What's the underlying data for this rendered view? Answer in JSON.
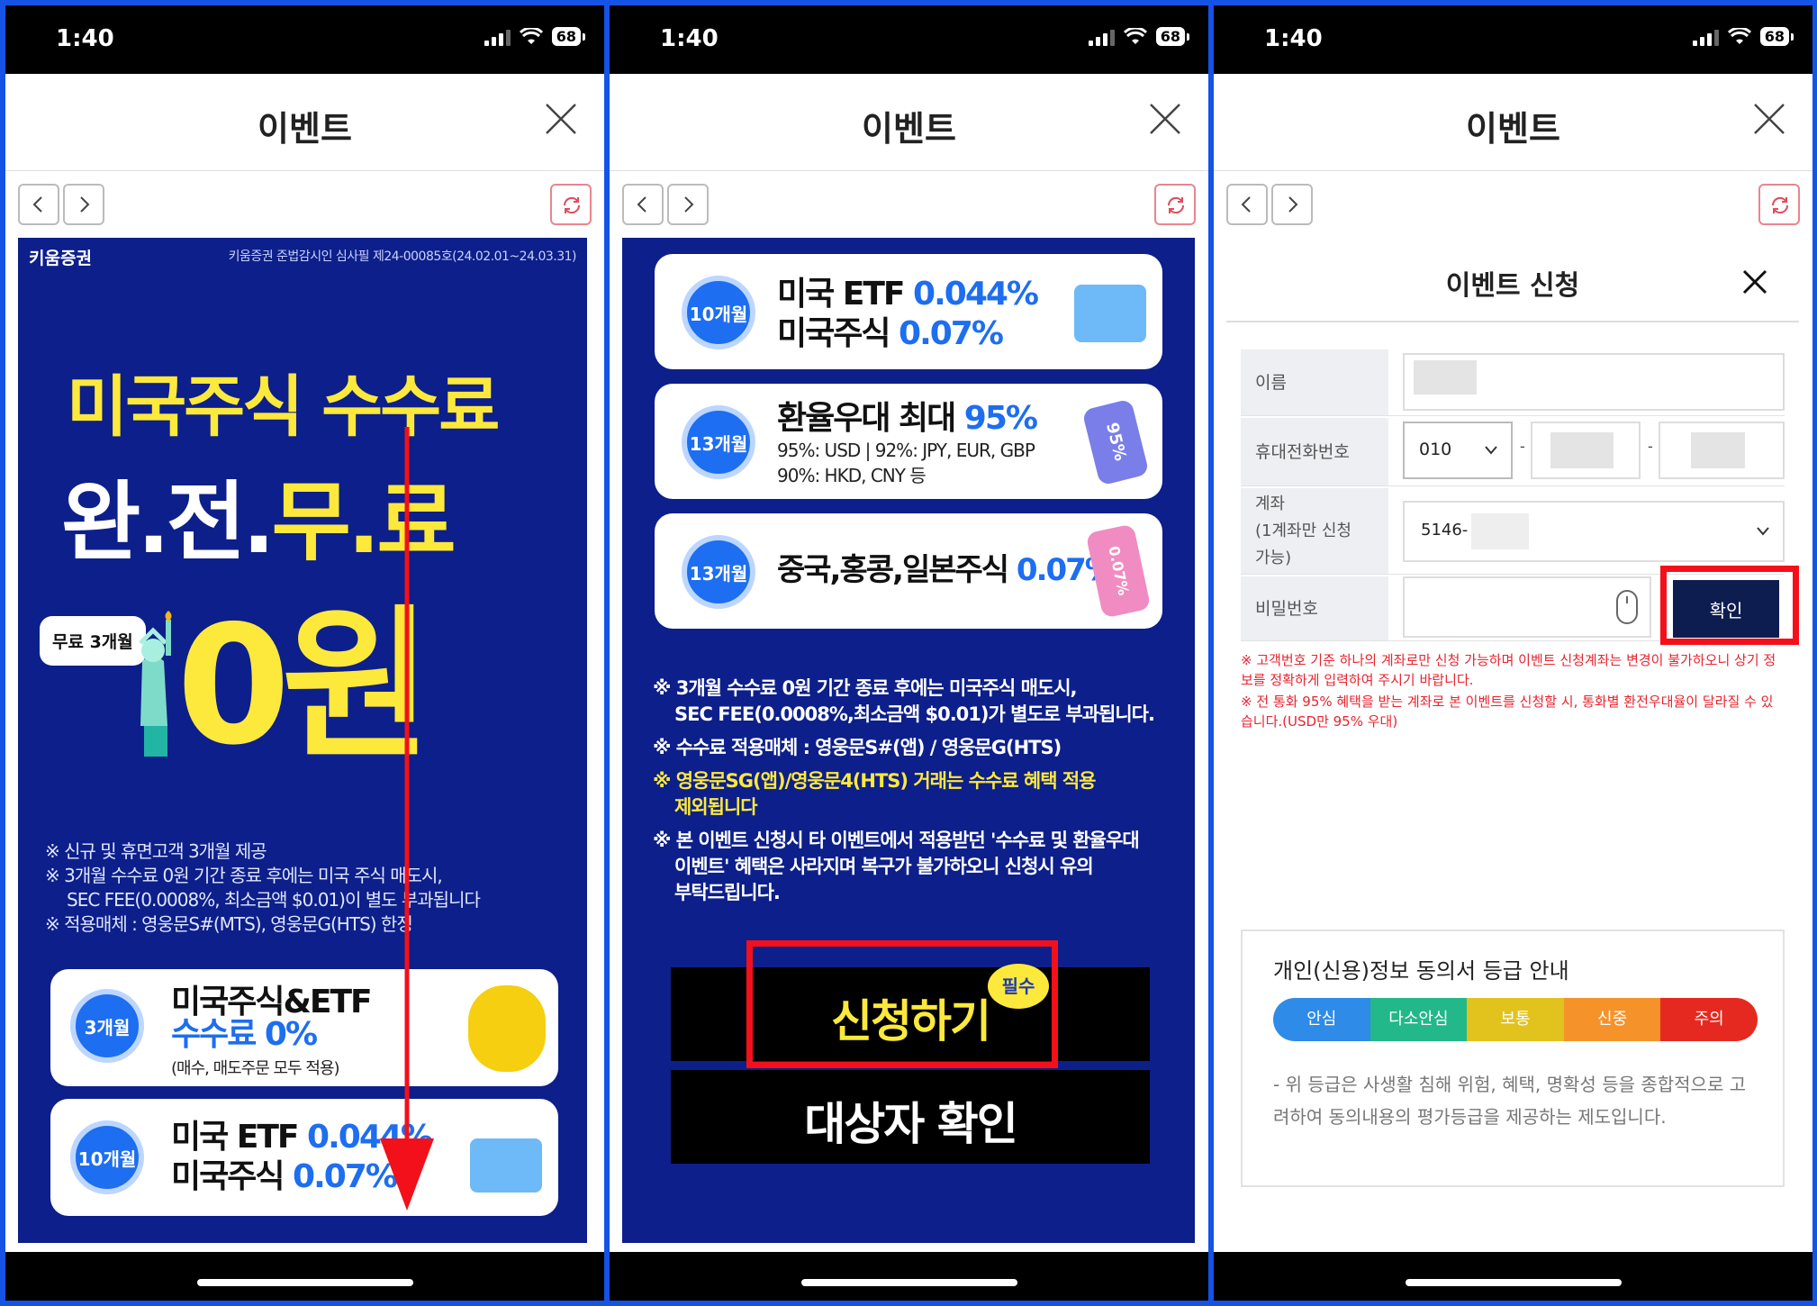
{
  "status": {
    "time": "1:40",
    "battery": "68"
  },
  "header": {
    "title": "이벤트"
  },
  "panel1": {
    "brand": "키움증권",
    "legal": "키움증권 준법감시인 심사필 제24-00085호(24.02.01~24.03.31)",
    "headline1": "미국주식 수수료",
    "headline2_white1": "완.전.",
    "headline2_yellow": "무.료",
    "free_badge": "무료 3개월",
    "zero": "0원",
    "notes": [
      "※ 신규 및 휴면고객 3개월 제공",
      "※ 3개월 수수료 0원 기간 종료 후에는 미국 주식 매도시,",
      "SEC FEE(0.0008%, 최소금액 $0.01)이 별도 부과됩니다",
      "※ 적용매체 : 영웅문S#(MTS), 영웅문G(HTS) 한정"
    ],
    "card1": {
      "badge": "3개월",
      "line1": "미국주식&ETF",
      "line2": "수수료 0%",
      "line3": "(매수, 매도주문 모두 적용)"
    },
    "card2": {
      "badge": "10개월",
      "line1a": "미국 ETF ",
      "line1b": "0.044%",
      "line2a": "미국주식 ",
      "line2b": "0.07%"
    }
  },
  "panel2": {
    "card1": {
      "badge": "10개월",
      "line1a": "미국 ETF ",
      "line1b": "0.044%",
      "line2a": "미국주식 ",
      "line2b": "0.07%"
    },
    "card2": {
      "badge": "13개월",
      "line1a": "환율우대 최대 ",
      "line1b": "95%",
      "line2": "95%: USD | 92%: JPY, EUR, GBP",
      "line3": "90%: HKD, CNY 등",
      "tag": "95%"
    },
    "card3": {
      "badge": "13개월",
      "line1a": "중국,홍콩,일본주식 ",
      "line1b": "0.07%",
      "tag": "0.07%"
    },
    "notes": [
      "※ 3개월 수수료 0원 기간 종료 후에는 미국주식 매도시,",
      "SEC FEE(0.0008%,최소금액 $0.01)가 별도로 부과됩니다.",
      "※ 수수료 적용매체 : 영웅문S#(앱) / 영웅문G(HTS)",
      "※ 영웅문SG(앱)/영웅문4(HTS) 거래는 수수료 혜택 적용",
      "제외됩니다",
      "※ 본 이벤트 신청시 타 이벤트에서 적용받던 '수수료 및 환율우대",
      "이벤트' 혜택은 사라지며 복구가 불가하오니 신청시 유의",
      "부탁드립니다."
    ],
    "apply_btn": "신청하기",
    "required": "필수",
    "check_btn": "대상자 확인"
  },
  "panel3": {
    "form_title": "이벤트 신청",
    "name_label": "이름",
    "phone_label": "휴대전화번호",
    "phone_prefix": "010",
    "account_label": "계좌\n(1계좌만 신청\n가능)",
    "account_value": "5146-",
    "password_label": "비밀번호",
    "confirm_btn": "확인",
    "warning1": "※ 고객번호 기준 하나의 계좌로만 신청 가능하며 이벤트 신청계좌는 변경이 불가하오니 상기 정보를 정확하게 입력하여 주시기 바랍니다.",
    "warning2": "※ 전 통화 95% 혜택을 받는 계좌로 본 이벤트를 신청할 시, 통화별 환전우대율이 달라질 수 있습니다.(USD만 95% 우대)",
    "info_title": "개인(신용)정보 동의서 등급 안내",
    "grades": [
      "안심",
      "다소안심",
      "보통",
      "신중",
      "주의"
    ],
    "grade_colors": [
      "#2f8be8",
      "#22b889",
      "#e2c31d",
      "#f5922a",
      "#e52920"
    ],
    "info_desc": "- 위 등급은 사생활 침해 위험, 혜택, 명확성 등을 종합적으로 고려하여 동의내용의 평가등급을 제공하는 제도입니다."
  }
}
